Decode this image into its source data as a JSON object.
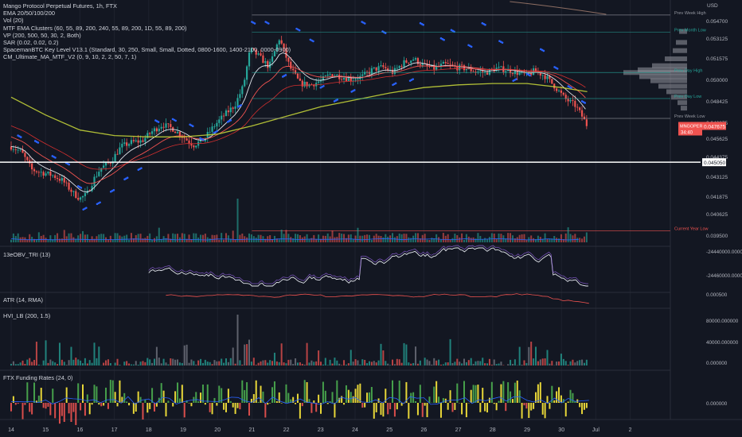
{
  "main": {
    "legend": [
      "Mango Protocol Perpetual Futures, 1h, FTX",
      "EMA 20/50/100/200",
      "Vol (20)",
      "MTF EMA Clusters (60, 55, 89, 200, 240, 55, 89, 200, 1D, 55, 89, 200)",
      "VP (200, 500, 50, 30, 2, Both)",
      "SAR (0.02, 0.02, 0.2)",
      "SpacemanBTC Key Level V13.1 (Standard, 30, 250, Small, Small, Dotted, 0800-1600, 1400-2100, 0000-0900)",
      "CM_Ultimate_MA_MTF_V2 (0, 9, 10, 2, 2, 50, 7, 1)"
    ],
    "currency": "USD",
    "key_levels": [
      {
        "label": "Prev Week High",
        "value": 0.0558,
        "color": "#9598a1"
      },
      {
        "label": "Prev Month Low",
        "value": 0.05455,
        "color": "#26a69a"
      },
      {
        "label": "Prev Day High",
        "value": 0.0516,
        "color": "#26a69a"
      },
      {
        "label": "Prev Day Low",
        "value": 0.0497,
        "color": "#26a69a"
      },
      {
        "label": "Prev Week Low",
        "value": 0.04825,
        "color": "#9598a1"
      },
      {
        "label": "Current Year Low",
        "value": 0.04005,
        "color": "#ef5350"
      }
    ],
    "horizontal_line": {
      "value": 0.04505,
      "label": "0.045050"
    },
    "price_label": {
      "symbol": "MNGOPERP",
      "value": "0.047675",
      "countdown": "34:40"
    },
    "y_ticks": [
      "0.054700",
      "0.053125",
      "0.051575",
      "0.050000",
      "0.048425",
      "0.046875",
      "0.045625",
      "0.044375",
      "0.043125",
      "0.041875",
      "0.040625",
      "0.039500"
    ]
  },
  "panes": [
    {
      "name": "13eOBV_TRI",
      "label": "13eOBV_TRI (13)",
      "ticks": [
        "-24440000.000000",
        "-24460000.000000",
        "0.000500"
      ]
    },
    {
      "name": "atr",
      "label": "ATR (14, RMA)",
      "ticks": []
    },
    {
      "name": "hvi",
      "label": "HVI_LB (200, 1.5)",
      "ticks": [
        "80000.000000",
        "40000.000000",
        "0.000000"
      ]
    },
    {
      "name": "funding",
      "label": "FTX Funding Rates (24, 0)",
      "ticks": [
        "0.000000"
      ]
    }
  ],
  "x_axis": {
    "labels": [
      "14",
      "15",
      "16",
      "17",
      "18",
      "19",
      "20",
      "21",
      "22",
      "23",
      "24",
      "25",
      "26",
      "27",
      "28",
      "29",
      "30",
      "Jul",
      "2"
    ]
  },
  "colors": {
    "bg": "#131722",
    "up": "#26a69a",
    "down": "#ef5350",
    "sar": "#2962ff",
    "grid": "#1e222d"
  },
  "chart_data": {
    "type": "candlestick",
    "title": "Mango Protocol Perpetual Futures, 1h, FTX",
    "x_labels": [
      "14",
      "15",
      "16",
      "17",
      "18",
      "19",
      "20",
      "21",
      "22",
      "23",
      "24",
      "25",
      "26",
      "27",
      "28",
      "29",
      "30",
      "Jul",
      "2"
    ],
    "ylim": [
      0.0392,
      0.0562
    ],
    "close_path": [
      [
        14.0,
        0.0462
      ],
      [
        14.3,
        0.0458
      ],
      [
        14.6,
        0.0445
      ],
      [
        14.9,
        0.0443
      ],
      [
        15.2,
        0.0441
      ],
      [
        15.5,
        0.0437
      ],
      [
        15.8,
        0.0428
      ],
      [
        16.0,
        0.0424
      ],
      [
        16.2,
        0.0427
      ],
      [
        16.4,
        0.0438
      ],
      [
        16.6,
        0.0446
      ],
      [
        16.9,
        0.0451
      ],
      [
        17.2,
        0.0462
      ],
      [
        17.5,
        0.0465
      ],
      [
        17.8,
        0.0466
      ],
      [
        18.1,
        0.0473
      ],
      [
        18.4,
        0.0478
      ],
      [
        18.7,
        0.0475
      ],
      [
        19.0,
        0.0469
      ],
      [
        19.3,
        0.0463
      ],
      [
        19.6,
        0.0467
      ],
      [
        19.9,
        0.0477
      ],
      [
        20.2,
        0.0485
      ],
      [
        20.5,
        0.0492
      ],
      [
        20.75,
        0.0506
      ],
      [
        20.95,
        0.0533
      ],
      [
        21.2,
        0.0528
      ],
      [
        21.5,
        0.052
      ],
      [
        21.8,
        0.0541
      ],
      [
        22.1,
        0.052
      ],
      [
        22.4,
        0.0508
      ],
      [
        22.7,
        0.0507
      ],
      [
        23.0,
        0.051
      ],
      [
        23.3,
        0.0515
      ],
      [
        23.6,
        0.0513
      ],
      [
        23.9,
        0.0511
      ],
      [
        24.2,
        0.0513
      ],
      [
        24.5,
        0.0518
      ],
      [
        24.8,
        0.052
      ],
      [
        25.1,
        0.0516
      ],
      [
        25.4,
        0.0523
      ],
      [
        25.7,
        0.0526
      ],
      [
        26.0,
        0.0521
      ],
      [
        26.3,
        0.0519
      ],
      [
        26.6,
        0.0522
      ],
      [
        26.9,
        0.052
      ],
      [
        27.2,
        0.0519
      ],
      [
        27.5,
        0.0517
      ],
      [
        27.8,
        0.0516
      ],
      [
        28.1,
        0.0519
      ],
      [
        28.4,
        0.0518
      ],
      [
        28.7,
        0.0516
      ],
      [
        29.0,
        0.0514
      ],
      [
        29.2,
        0.0517
      ],
      [
        29.5,
        0.0514
      ],
      [
        29.8,
        0.0506
      ],
      [
        30.1,
        0.0497
      ],
      [
        30.4,
        0.0492
      ],
      [
        30.6,
        0.0484
      ],
      [
        30.75,
        0.0477
      ]
    ],
    "ema200": [
      [
        14.0,
        0.0498
      ],
      [
        15.0,
        0.0485
      ],
      [
        16.0,
        0.0474
      ],
      [
        17.0,
        0.047
      ],
      [
        18.0,
        0.0469
      ],
      [
        19.0,
        0.0469
      ],
      [
        20.0,
        0.0471
      ],
      [
        21.0,
        0.0477
      ],
      [
        22.0,
        0.0484
      ],
      [
        23.0,
        0.0491
      ],
      [
        24.0,
        0.0496
      ],
      [
        25.0,
        0.0501
      ],
      [
        26.0,
        0.0505
      ],
      [
        27.0,
        0.0507
      ],
      [
        28.0,
        0.0508
      ],
      [
        29.0,
        0.0508
      ],
      [
        30.0,
        0.0505
      ],
      [
        30.75,
        0.0502
      ]
    ],
    "sar": [
      [
        14.2,
        0.047
      ],
      [
        14.7,
        0.0466
      ],
      [
        15.2,
        0.0455
      ],
      [
        15.6,
        0.045
      ],
      [
        15.95,
        0.0433
      ],
      [
        16.1,
        0.0416
      ],
      [
        16.5,
        0.042
      ],
      [
        16.9,
        0.0429
      ],
      [
        17.3,
        0.0438
      ],
      [
        17.7,
        0.0445
      ],
      [
        18.2,
        0.0481
      ],
      [
        18.7,
        0.0482
      ],
      [
        19.2,
        0.0478
      ],
      [
        19.5,
        0.0468
      ],
      [
        19.9,
        0.0472
      ],
      [
        20.3,
        0.048
      ],
      [
        20.6,
        0.0491
      ],
      [
        21.0,
        0.0553
      ],
      [
        21.4,
        0.0553
      ],
      [
        21.9,
        0.0513
      ],
      [
        22.3,
        0.0548
      ],
      [
        22.7,
        0.054
      ],
      [
        23.0,
        0.0505
      ],
      [
        23.4,
        0.0495
      ],
      [
        23.9,
        0.0502
      ],
      [
        24.2,
        0.0553
      ],
      [
        24.8,
        0.0546
      ],
      [
        25.1,
        0.0507
      ],
      [
        25.6,
        0.051
      ],
      [
        25.9,
        0.0552
      ],
      [
        26.5,
        0.0541
      ],
      [
        26.8,
        0.0547
      ],
      [
        27.3,
        0.0536
      ],
      [
        27.7,
        0.0552
      ],
      [
        28.2,
        0.0539
      ],
      [
        28.6,
        0.051
      ],
      [
        29.0,
        0.0515
      ],
      [
        29.4,
        0.0533
      ],
      [
        29.8,
        0.052
      ],
      [
        30.2,
        0.0506
      ],
      [
        30.6,
        0.0495
      ]
    ]
  }
}
